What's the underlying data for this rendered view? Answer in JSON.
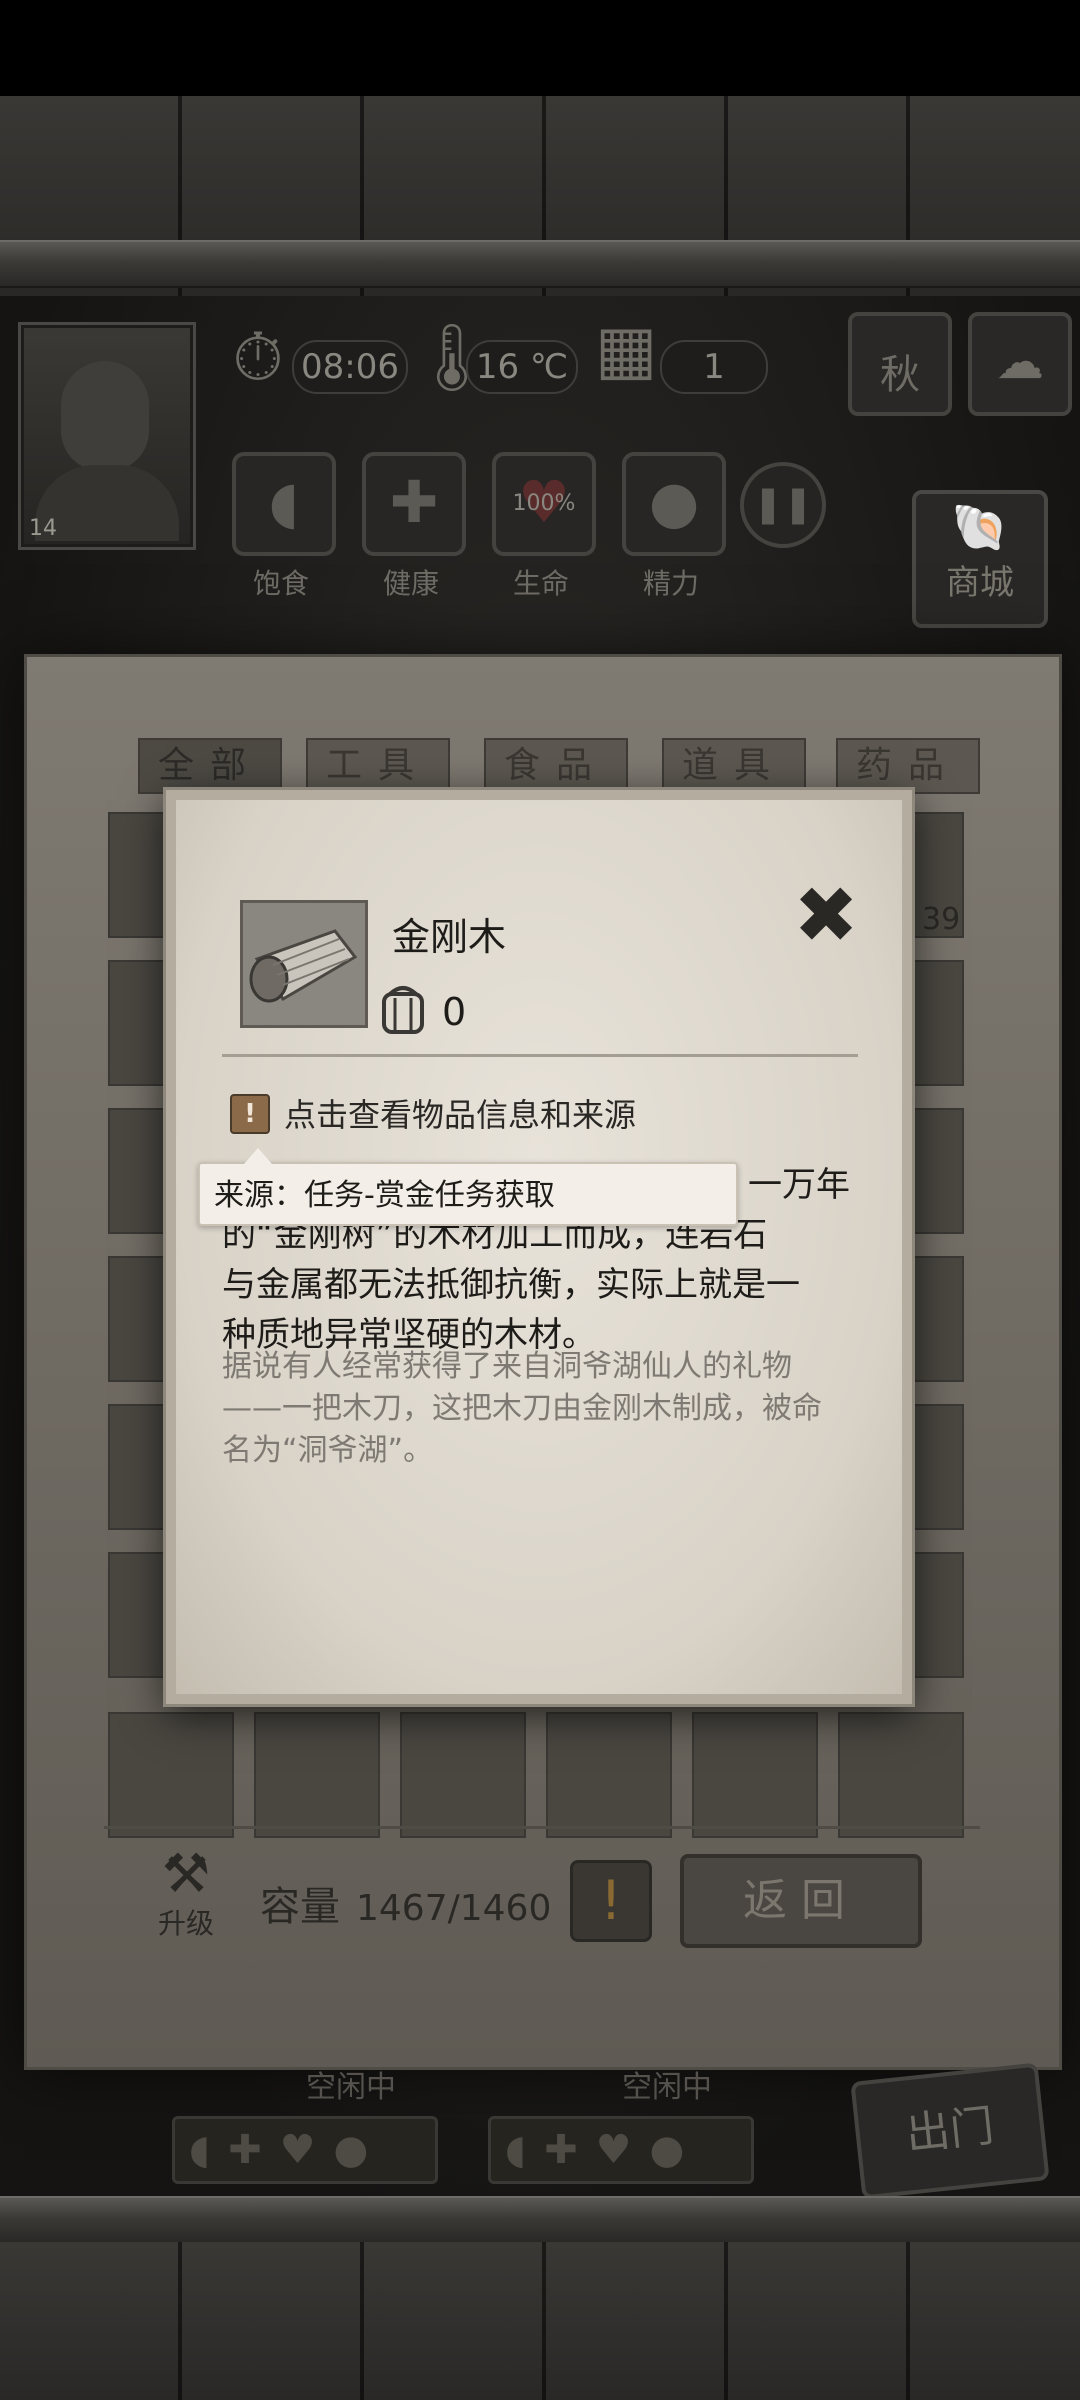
{
  "hud": {
    "time": "08:06",
    "temperature": "16 ℃",
    "day": "1",
    "season": "秋",
    "level": "14",
    "stats": [
      {
        "label": "饱食",
        "icon": "stomach-icon"
      },
      {
        "label": "健康",
        "icon": "plus-icon"
      },
      {
        "label": "生命",
        "icon": "heart-icon",
        "value": "100%"
      },
      {
        "label": "精力",
        "icon": "person-icon"
      }
    ],
    "shop_label": "商城"
  },
  "inventory": {
    "tabs": [
      "全部",
      "工具",
      "食品",
      "道具",
      "药品"
    ],
    "active_tab": "全部",
    "first_slot_count": "39",
    "capacity_label": "容量",
    "capacity_value": "1467/1460",
    "upgrade_label": "升级",
    "return_label": "返回"
  },
  "background": {
    "idle_1": "空闲中",
    "idle_2": "空闲中",
    "go_out_label": "出门"
  },
  "dialog": {
    "item_name": "金刚木",
    "item_count": "0",
    "source_link": "点击查看物品信息和来源",
    "tooltip": "来源：任务-赏金任务获取",
    "description_visible_1": "一万年",
    "description_visible_2": "的“金刚树”的木材加工而成，连岩石",
    "description_line_3": "与金属都无法抵御抗衡，实际上就是一",
    "description_line_4": "种质地异常坚硬的木材。",
    "lore": "据说有人经常获得了来自洞爷湖仙人的礼物——一把木刀，这把木刀由金刚木制成，被命名为“洞爷湖”。"
  }
}
